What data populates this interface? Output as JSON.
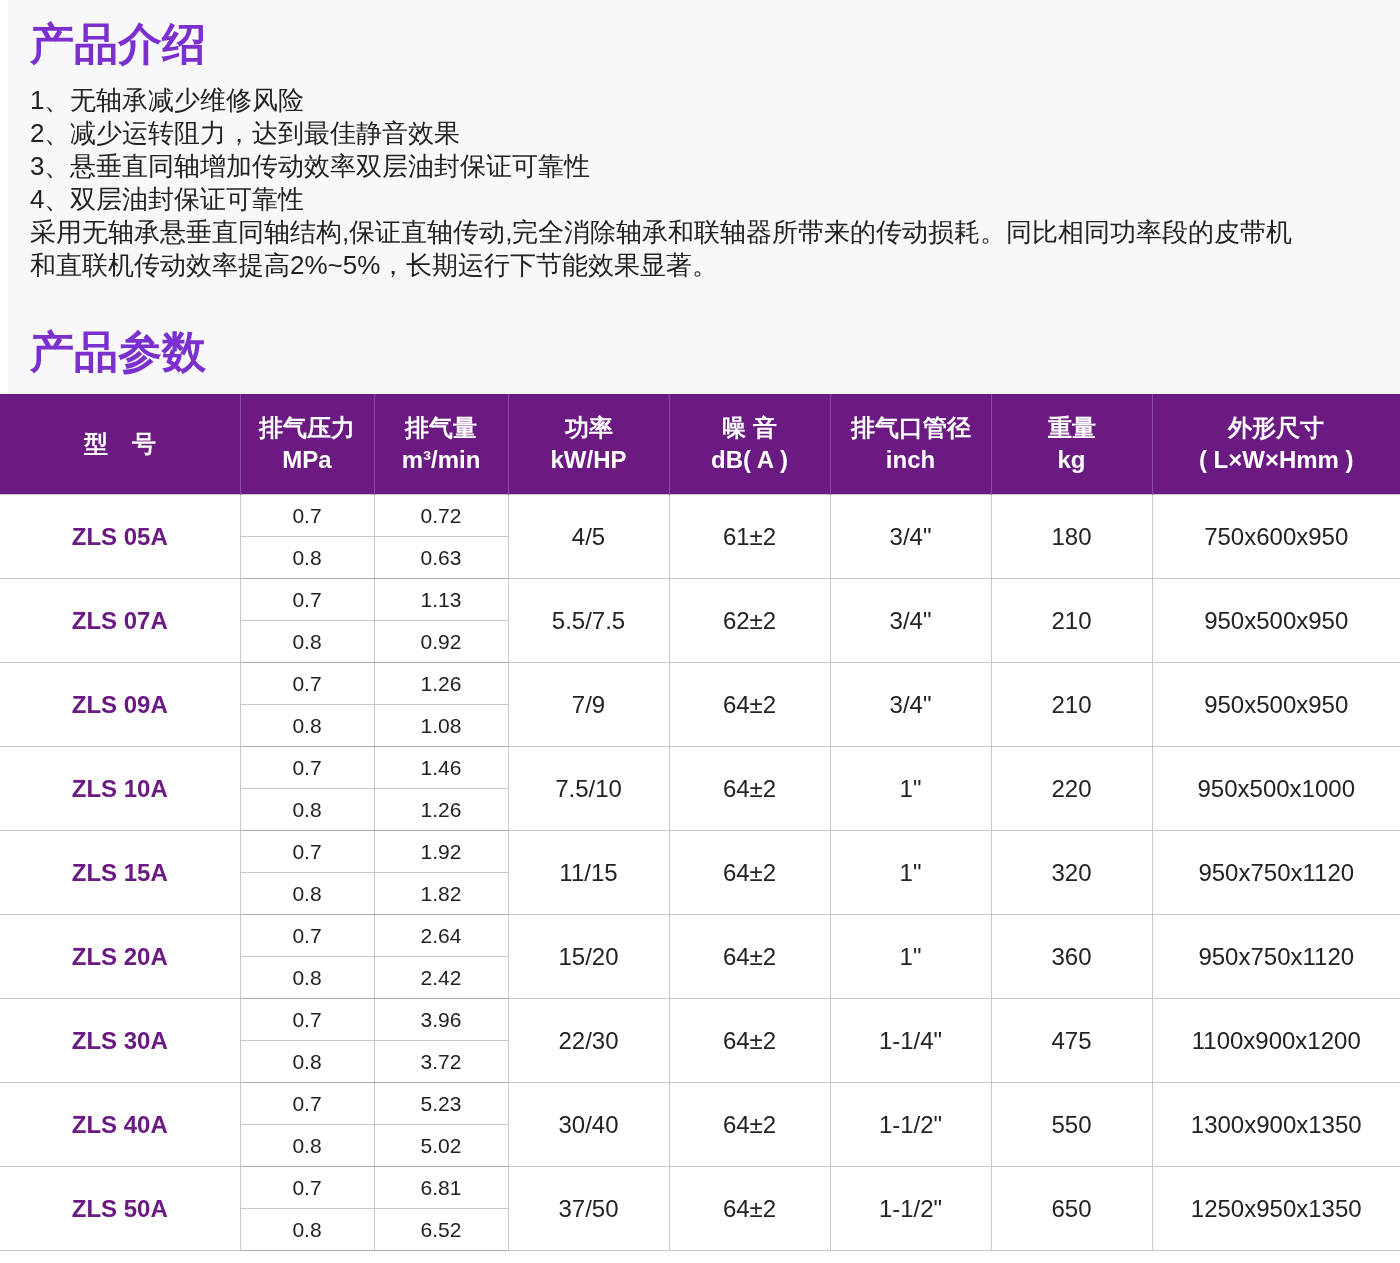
{
  "intro": {
    "title": "产品介绍",
    "items": [
      "1、无轴承减少维修风险",
      "2、减少运转阻力，达到最佳静音效果",
      "3、悬垂直同轴增加传动效率双层油封保证可靠性",
      "4、双层油封保证可靠性"
    ],
    "paragraph": "采用无轴承悬垂直同轴结构,保证直轴传动,完全消除轴承和联轴器所带来的传动损耗。同比相同功率段的皮带机和直联机传动效率提高2%~5%，长期运行下节能效果显著。"
  },
  "params": {
    "title": "产品参数",
    "columns": [
      [
        "型　号"
      ],
      [
        "排气压力",
        "MPa"
      ],
      [
        "排气量",
        "m³/min"
      ],
      [
        "功率",
        "kW/HP"
      ],
      [
        "噪 音",
        "dB( A )"
      ],
      [
        "排气口管径",
        "inch"
      ],
      [
        "重量",
        "kg"
      ],
      [
        "外形尺寸",
        "( L×W×Hmm )"
      ]
    ],
    "rows": [
      {
        "model": "ZLS 05A",
        "sub": [
          [
            "0.7",
            "0.72"
          ],
          [
            "0.8",
            "0.63"
          ]
        ],
        "power": "4/5",
        "noise": "61±2",
        "outlet": "3/4\"",
        "weight": "180",
        "size": "750x600x950"
      },
      {
        "model": "ZLS 07A",
        "sub": [
          [
            "0.7",
            "1.13"
          ],
          [
            "0.8",
            "0.92"
          ]
        ],
        "power": "5.5/7.5",
        "noise": "62±2",
        "outlet": "3/4\"",
        "weight": "210",
        "size": "950x500x950"
      },
      {
        "model": "ZLS 09A",
        "sub": [
          [
            "0.7",
            "1.26"
          ],
          [
            "0.8",
            "1.08"
          ]
        ],
        "power": "7/9",
        "noise": "64±2",
        "outlet": "3/4\"",
        "weight": "210",
        "size": "950x500x950"
      },
      {
        "model": "ZLS 10A",
        "sub": [
          [
            "0.7",
            "1.46"
          ],
          [
            "0.8",
            "1.26"
          ]
        ],
        "power": "7.5/10",
        "noise": "64±2",
        "outlet": "1\"",
        "weight": "220",
        "size": "950x500x1000"
      },
      {
        "model": "ZLS 15A",
        "sub": [
          [
            "0.7",
            "1.92"
          ],
          [
            "0.8",
            "1.82"
          ]
        ],
        "power": "11/15",
        "noise": "64±2",
        "outlet": "1\"",
        "weight": "320",
        "size": "950x750x1120"
      },
      {
        "model": "ZLS 20A",
        "sub": [
          [
            "0.7",
            "2.64"
          ],
          [
            "0.8",
            "2.42"
          ]
        ],
        "power": "15/20",
        "noise": "64±2",
        "outlet": "1\"",
        "weight": "360",
        "size": "950x750x1120"
      },
      {
        "model": "ZLS 30A",
        "sub": [
          [
            "0.7",
            "3.96"
          ],
          [
            "0.8",
            "3.72"
          ]
        ],
        "power": "22/30",
        "noise": "64±2",
        "outlet": "1-1/4\"",
        "weight": "475",
        "size": "1100x900x1200"
      },
      {
        "model": "ZLS 40A",
        "sub": [
          [
            "0.7",
            "5.23"
          ],
          [
            "0.8",
            "5.02"
          ]
        ],
        "power": "30/40",
        "noise": "64±2",
        "outlet": "1-1/2\"",
        "weight": "550",
        "size": "1300x900x1350"
      },
      {
        "model": "ZLS 50A",
        "sub": [
          [
            "0.7",
            "6.81"
          ],
          [
            "0.8",
            "6.52"
          ]
        ],
        "power": "37/50",
        "noise": "64±2",
        "outlet": "1-1/2\"",
        "weight": "650",
        "size": "1250x950x1350"
      }
    ]
  }
}
